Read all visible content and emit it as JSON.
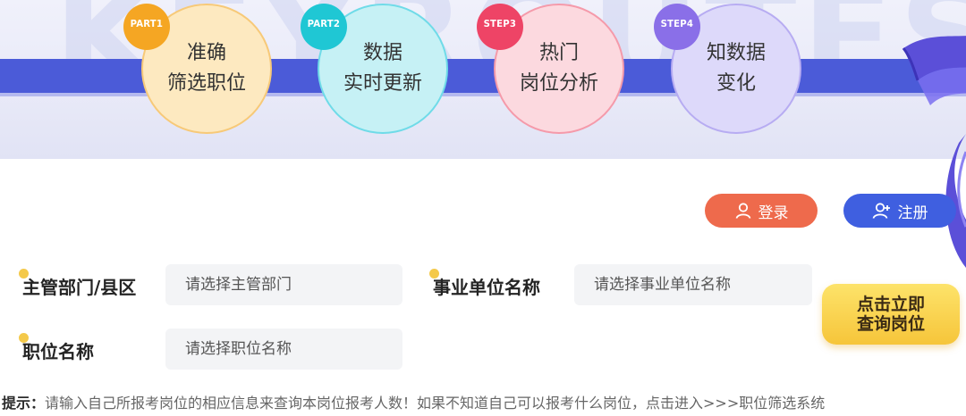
{
  "banner": {
    "watermark": "KEYROUTES",
    "steps": [
      {
        "badge": "PART1",
        "lines": [
          "准确",
          "筛选职位"
        ],
        "fill": "#fde9c0",
        "border": "#f7c978",
        "badge_color": "#f5a623"
      },
      {
        "badge": "PART2",
        "lines": [
          "数据",
          "实时更新"
        ],
        "fill": "#c6f1f5",
        "border": "#6fdbe8",
        "badge_color": "#1fc7d4"
      },
      {
        "badge": "STEP3",
        "lines": [
          "热门",
          "岗位分析"
        ],
        "fill": "#fcd9df",
        "border": "#f59aaa",
        "badge_color": "#ee4466"
      },
      {
        "badge": "STEP4",
        "lines": [
          "知数据",
          "变化"
        ],
        "fill": "#ddd9fa",
        "border": "#b7acf2",
        "badge_color": "#8a6fe8"
      }
    ]
  },
  "auth": {
    "login_label": "登录",
    "register_label": "注册",
    "login_color": "#ee6a4c",
    "register_color": "#3f5fe0"
  },
  "form": {
    "dept_label": "主管部门/县区",
    "dept_placeholder": "请选择主管部门",
    "unit_label": "事业单位名称",
    "unit_placeholder": "请选择事业单位名称",
    "position_label": "职位名称",
    "position_placeholder": "请选择职位名称",
    "query_line1": "点击立即",
    "query_line2": "查询岗位"
  },
  "hint": {
    "prefix": "提示：",
    "text": "请输入自己所报考岗位的相应信息来查询本岗位报考人数！如果不知道自己可以报考什么岗位，点击进入>>>职位筛选系统"
  },
  "icons": {
    "login": "user-icon",
    "register": "user-plus-icon"
  }
}
